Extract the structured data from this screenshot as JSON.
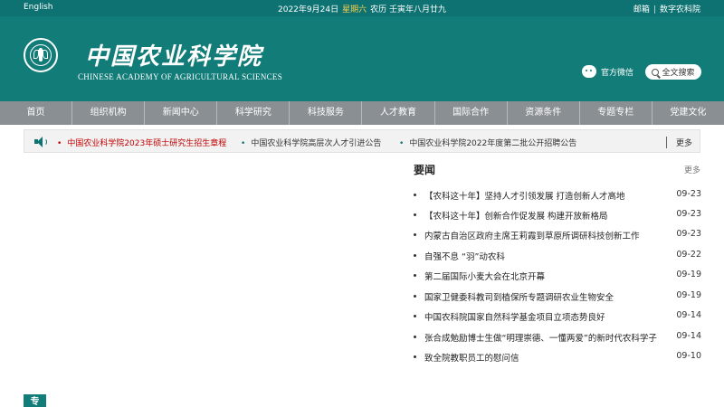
{
  "topbar": {
    "lang": "English",
    "date": "2022年9月24日",
    "weekday": "星期六",
    "lunar": "农历  壬寅年八月廿九",
    "links": [
      "邮箱",
      "数字农科院"
    ]
  },
  "header": {
    "logo_cn": "中国农业科学院",
    "logo_en": "CHINESE ACADEMY OF AGRICULTURAL SCIENCES",
    "wechat_label": "官方微信",
    "search_label": "全文搜索"
  },
  "nav": [
    "首页",
    "组织机构",
    "新闻中心",
    "科学研究",
    "科技服务",
    "人才教育",
    "国际合作",
    "资源条件",
    "专题专栏",
    "党建文化"
  ],
  "notice": {
    "items": [
      "中国农业科学院2023年硕士研究生招生章程",
      "中国农业科学院高层次人才引进公告",
      "中国农业科学院2022年度第二批公开招聘公告"
    ],
    "more": "更多",
    "colors": {
      "highlight": "#c20000"
    }
  },
  "news": {
    "title": "要闻",
    "more": "更多",
    "items": [
      {
        "title": "【农科这十年】坚持人才引领发展 打造创新人才高地",
        "date": "09-23"
      },
      {
        "title": "【农科这十年】创新合作促发展 构建开放新格局",
        "date": "09-23"
      },
      {
        "title": "内蒙古自治区政府主席王莉霞到草原所调研科技创新工作",
        "date": "09-23"
      },
      {
        "title": "自强不息 “羽”动农科",
        "date": "09-22"
      },
      {
        "title": "第二届国际小麦大会在北京开幕",
        "date": "09-19"
      },
      {
        "title": "国家卫健委科教司到植保所专题调研农业生物安全",
        "date": "09-19"
      },
      {
        "title": "中国农科院国家自然科学基金项目立项态势良好",
        "date": "09-14"
      },
      {
        "title": "张合成勉励博士生做“明理崇德、一懂两爱”的新时代农科学子",
        "date": "09-14"
      },
      {
        "title": "致全院教职员工的慰问信",
        "date": "09-10"
      }
    ]
  },
  "special_label": "专",
  "colors": {
    "brand": "#127c79",
    "nav": "#8a8f93",
    "weekday": "#ffd34d"
  }
}
